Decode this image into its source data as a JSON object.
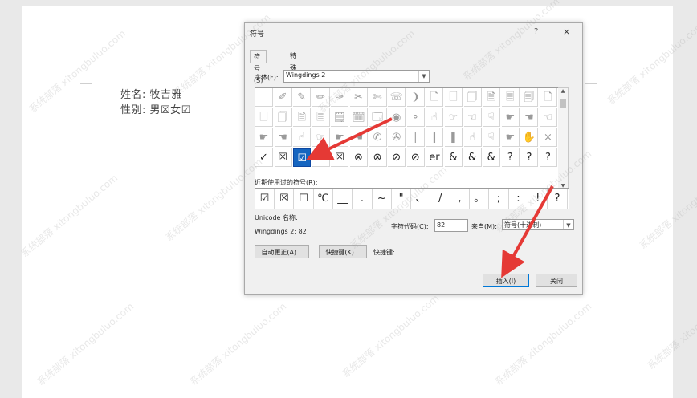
{
  "document": {
    "line1_label": "姓名:",
    "line1_value": "牧吉雅",
    "line2_label": "性别:",
    "line2_value": "男☒女☑"
  },
  "dialog": {
    "title": "符号",
    "help": "?",
    "close": "×",
    "tabs": [
      "符号(S)",
      "特殊字符(P)"
    ],
    "font_label": "字体(F):",
    "font_value": "Wingdings 2",
    "symbol_rows": [
      [
        "",
        "✐",
        "✎",
        "✏",
        "✑",
        "✂",
        "✄",
        "☏",
        "❩",
        "🗋",
        "🗌",
        "🗍",
        "🗎",
        "🗏",
        "🗐",
        "🗋"
      ],
      [
        "🗌",
        "🗍",
        "🗎",
        "🗏",
        "🗒",
        "🗓",
        "🗔",
        "◉",
        "⚬",
        "☝",
        "☞",
        "☜",
        "☟",
        "☛",
        "☚",
        "☜"
      ],
      [
        "☛",
        "☚",
        "☝",
        "☞",
        "☛",
        "☚",
        "✆",
        "✇",
        "❘",
        "❙",
        "❚",
        "☝",
        "☟",
        "☛",
        "✋",
        "×"
      ],
      [
        "✓",
        "☒",
        "☑",
        "☒",
        "☒",
        "⊗",
        "⊗",
        "⊘",
        "⊘",
        "er",
        "&",
        "&",
        "&",
        "?",
        "?",
        "?"
      ]
    ],
    "selected_symbol": "☑",
    "recent_label": "近期使用过的符号(R):",
    "recent_symbols": [
      "☑",
      "☒",
      "☐",
      "℃",
      "__",
      ".",
      "~",
      "\"",
      "、",
      "/",
      ",",
      "。",
      ";",
      ":",
      "!",
      "?"
    ],
    "unicode_label": "Unicode 名称:",
    "unicode_value": "Wingdings 2: 82",
    "char_code_label": "字符代码(C):",
    "char_code_value": "82",
    "from_label": "来自(M):",
    "from_value": "符号(十进制)",
    "autocorrect_button": "自动更正(A)...",
    "shortcut_key_button": "快捷键(K)...",
    "shortcut_label": "快捷键:",
    "insert_button": "插入(I)",
    "close_button": "关闭"
  },
  "colors": {
    "selection": "#1565c0",
    "arrow": "#e53935"
  },
  "watermark": "系统部落 xitongbuluo.com"
}
